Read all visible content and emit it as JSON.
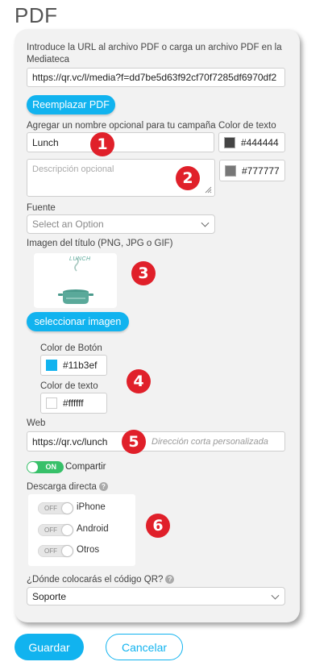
{
  "page_title": "PDF",
  "url_section": {
    "label": "Introduce la URL al archivo PDF o carga un archivo PDF en la Mediateca",
    "url_value": "https://qr.vc/l/media?f=dd7be5d63f92cf70f7285df6970df2",
    "replace_button": "Reemplazar PDF"
  },
  "campaign": {
    "name_label": "Agregar un nombre opcional para tu campaña",
    "name_value": "Lunch",
    "text_color_label": "Color de texto",
    "text_color_value": "#444444",
    "text_color_hex": "#444444",
    "description_placeholder": "Descripción opcional",
    "description_color_value": "#777777",
    "description_color_hex": "#777777"
  },
  "font": {
    "label": "Fuente",
    "placeholder": "Select an Option"
  },
  "title_image": {
    "label": "Imagen del título (PNG, JPG o GIF)",
    "thumbnail_text": "LUNCH",
    "select_button": "seleccionar imagen"
  },
  "button_colors": {
    "button_color_label": "Color de Botón",
    "button_color_value": "#11b3ef",
    "button_color_hex": "#11b3ef",
    "text_color_label": "Color de texto",
    "text_color_value": "#ffffff",
    "text_color_hex": "#ffffff"
  },
  "web": {
    "label": "Web",
    "prefix": "https://qr.vc/lunch",
    "placeholder": "Dirección corta personalizada"
  },
  "share": {
    "toggle_text": "ON",
    "label": "Compartir"
  },
  "direct_download": {
    "label": "Descarga directa",
    "options": [
      {
        "toggle_text": "OFF",
        "label": "iPhone"
      },
      {
        "toggle_text": "OFF",
        "label": "Android"
      },
      {
        "toggle_text": "OFF",
        "label": "Otros"
      }
    ]
  },
  "qr_placement": {
    "label": "¿Dónde colocarás el código QR?",
    "selected": "Soporte"
  },
  "badges": [
    "1",
    "2",
    "3",
    "4",
    "5",
    "6"
  ],
  "actions": {
    "save": "Guardar",
    "cancel": "Cancelar"
  },
  "colors": {
    "accent": "#11b3ef",
    "badge": "#e0202a",
    "toggle_on": "#37c069"
  }
}
